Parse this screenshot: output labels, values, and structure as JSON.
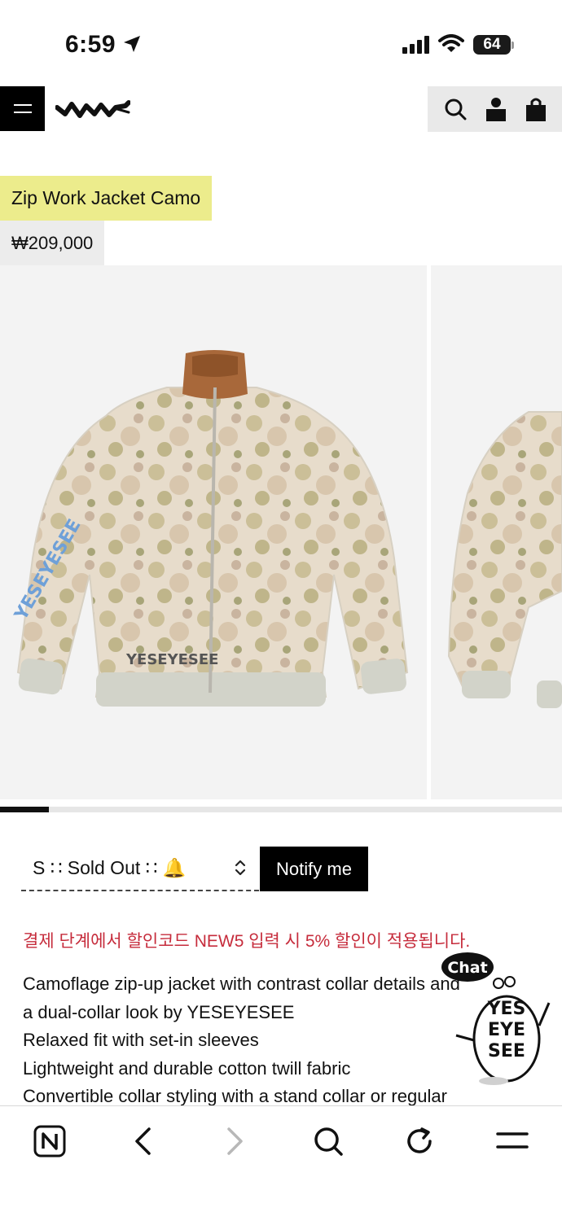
{
  "status_bar": {
    "time": "6:59",
    "battery": "64"
  },
  "header": {
    "logo_alt": "YESEYESEE",
    "icons": [
      "menu-icon",
      "search-icon",
      "account-icon",
      "bag-icon"
    ]
  },
  "product": {
    "title": "Zip Work Jacket Camo",
    "price": "₩209,000",
    "gallery_progress": 0.087
  },
  "options": {
    "size_selected": "S ∷ Sold Out ∷ 🔔",
    "notify_label": "Notify me"
  },
  "promo_text": "결제 단계에서 할인코드 NEW5 입력 시 5% 할인이 적용됩니다.",
  "description": [
    "Camoflage zip-up jacket with contrast collar details and",
    "a dual-collar look by YESEYESEE",
    "Relaxed fit with set-in sleeves",
    "Lightweight and durable cotton twill fabric",
    "Convertible collar styling with a stand collar or regular"
  ],
  "chat_widget": {
    "label": "Chat"
  },
  "browser_bar": {
    "icons": [
      "naver-icon",
      "back-icon",
      "forward-icon",
      "search-icon",
      "reload-icon",
      "hamburger-icon"
    ]
  },
  "colors": {
    "title_bg": "#ecec8c",
    "price_bg": "#ececec",
    "promo": "#c62c3c"
  }
}
